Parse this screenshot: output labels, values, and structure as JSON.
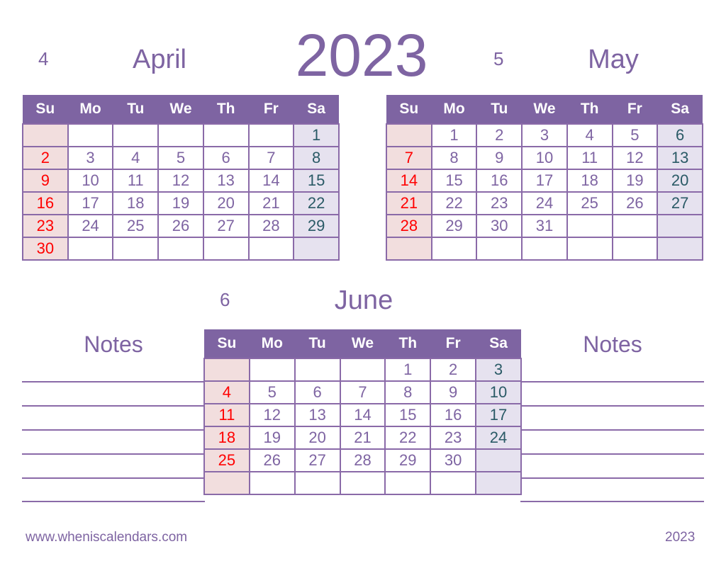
{
  "year_title": "2023",
  "weekdays": [
    "Su",
    "Mo",
    "Tu",
    "We",
    "Th",
    "Fr",
    "Sa"
  ],
  "months": [
    {
      "number": "4",
      "name": "April",
      "weeks": [
        [
          "",
          "",
          "",
          "",
          "",
          "",
          "1"
        ],
        [
          "2",
          "3",
          "4",
          "5",
          "6",
          "7",
          "8"
        ],
        [
          "9",
          "10",
          "11",
          "12",
          "13",
          "14",
          "15"
        ],
        [
          "16",
          "17",
          "18",
          "19",
          "20",
          "21",
          "22"
        ],
        [
          "23",
          "24",
          "25",
          "26",
          "27",
          "28",
          "29"
        ],
        [
          "30",
          "",
          "",
          "",
          "",
          "",
          ""
        ]
      ]
    },
    {
      "number": "5",
      "name": "May",
      "weeks": [
        [
          "",
          "1",
          "2",
          "3",
          "4",
          "5",
          "6"
        ],
        [
          "7",
          "8",
          "9",
          "10",
          "11",
          "12",
          "13"
        ],
        [
          "14",
          "15",
          "16",
          "17",
          "18",
          "19",
          "20"
        ],
        [
          "21",
          "22",
          "23",
          "24",
          "25",
          "26",
          "27"
        ],
        [
          "28",
          "29",
          "30",
          "31",
          "",
          "",
          ""
        ],
        [
          "",
          "",
          "",
          "",
          "",
          "",
          ""
        ]
      ]
    },
    {
      "number": "6",
      "name": "June",
      "weeks": [
        [
          "",
          "",
          "",
          "",
          "1",
          "2",
          "3"
        ],
        [
          "4",
          "5",
          "6",
          "7",
          "8",
          "9",
          "10"
        ],
        [
          "11",
          "12",
          "13",
          "14",
          "15",
          "16",
          "17"
        ],
        [
          "18",
          "19",
          "20",
          "21",
          "22",
          "23",
          "24"
        ],
        [
          "25",
          "26",
          "27",
          "28",
          "29",
          "30",
          ""
        ],
        [
          "",
          "",
          "",
          "",
          "",
          "",
          ""
        ]
      ]
    }
  ],
  "notes": {
    "left_title": "Notes",
    "right_title": "Notes"
  },
  "footer": {
    "website": "www.wheniscalendars.com",
    "year": "2023"
  },
  "colors": {
    "accent": "#7e64a2",
    "sunday_text": "#ff0000",
    "sunday_bg": "#f2dede",
    "saturday_text": "#2a5a66",
    "saturday_bg": "#e6e2ef"
  }
}
